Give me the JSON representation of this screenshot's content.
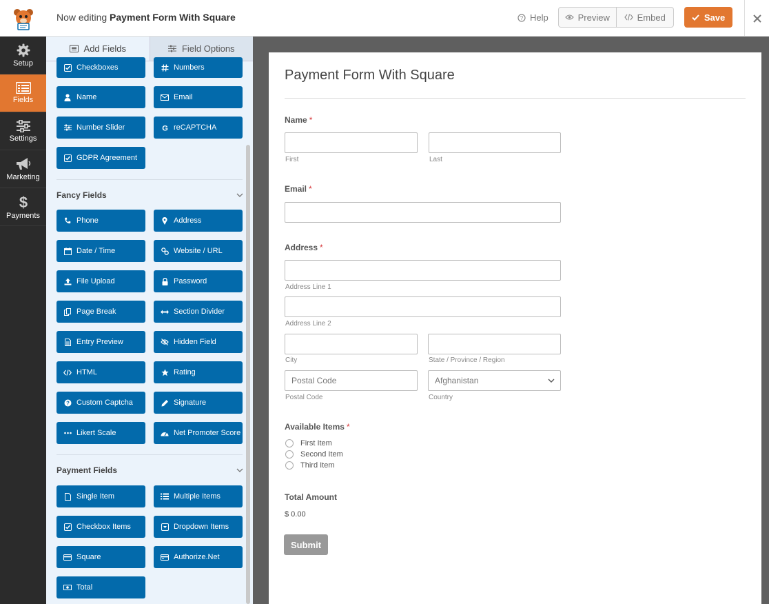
{
  "header": {
    "editing_prefix": "Now editing",
    "form_name": "Payment Form With Square",
    "help_label": "Help",
    "preview_label": "Preview",
    "embed_label": "Embed",
    "save_label": "Save",
    "accent_color": "#e27730"
  },
  "leftnav": {
    "items": [
      {
        "label": "Setup",
        "icon": "gear-icon"
      },
      {
        "label": "Fields",
        "icon": "list-icon",
        "active": true
      },
      {
        "label": "Settings",
        "icon": "sliders-icon"
      },
      {
        "label": "Marketing",
        "icon": "megaphone-icon"
      },
      {
        "label": "Payments",
        "icon": "dollar-icon"
      }
    ]
  },
  "panel": {
    "tabs": {
      "add_fields": "Add Fields",
      "field_options": "Field Options"
    },
    "standard_fields": [
      {
        "label": "Checkboxes",
        "icon": "checkbox-icon"
      },
      {
        "label": "Numbers",
        "icon": "hash-icon"
      },
      {
        "label": "Name",
        "icon": "user-icon"
      },
      {
        "label": "Email",
        "icon": "envelope-icon"
      },
      {
        "label": "Number Slider",
        "icon": "sliders-icon"
      },
      {
        "label": "reCAPTCHA",
        "icon": "google-icon"
      },
      {
        "label": "GDPR Agreement",
        "icon": "checkbox-icon"
      }
    ],
    "fancy_title": "Fancy Fields",
    "fancy_fields": [
      {
        "label": "Phone",
        "icon": "phone-icon"
      },
      {
        "label": "Address",
        "icon": "map-pin-icon"
      },
      {
        "label": "Date / Time",
        "icon": "calendar-icon"
      },
      {
        "label": "Website / URL",
        "icon": "link-icon"
      },
      {
        "label": "File Upload",
        "icon": "upload-icon"
      },
      {
        "label": "Password",
        "icon": "lock-icon"
      },
      {
        "label": "Page Break",
        "icon": "copy-icon"
      },
      {
        "label": "Section Divider",
        "icon": "arrows-h-icon"
      },
      {
        "label": "Entry Preview",
        "icon": "file-text-icon"
      },
      {
        "label": "Hidden Field",
        "icon": "eye-slash-icon"
      },
      {
        "label": "HTML",
        "icon": "code-icon"
      },
      {
        "label": "Rating",
        "icon": "star-icon"
      },
      {
        "label": "Custom Captcha",
        "icon": "question-circle-icon"
      },
      {
        "label": "Signature",
        "icon": "pencil-icon"
      },
      {
        "label": "Likert Scale",
        "icon": "ellipsis-icon"
      },
      {
        "label": "Net Promoter Score",
        "icon": "tachometer-icon"
      }
    ],
    "payment_title": "Payment Fields",
    "payment_fields": [
      {
        "label": "Single Item",
        "icon": "file-icon"
      },
      {
        "label": "Multiple Items",
        "icon": "list-icon"
      },
      {
        "label": "Checkbox Items",
        "icon": "checkbox-icon"
      },
      {
        "label": "Dropdown Items",
        "icon": "caret-square-icon"
      },
      {
        "label": "Square",
        "icon": "credit-card-icon"
      },
      {
        "label": "Authorize.Net",
        "icon": "bank-icon"
      },
      {
        "label": "Total",
        "icon": "money-icon"
      }
    ],
    "button_color": "#036aab"
  },
  "form": {
    "title": "Payment Form With Square",
    "name": {
      "label": "Name",
      "req": "*",
      "first": "First",
      "last": "Last"
    },
    "email": {
      "label": "Email",
      "req": "*"
    },
    "address": {
      "label": "Address",
      "req": "*",
      "line1": "Address Line 1",
      "line2": "Address Line 2",
      "city": "City",
      "state": "State / Province / Region",
      "postal_placeholder": "Postal Code",
      "postal": "Postal Code",
      "country_value": "Afghanistan",
      "country": "Country"
    },
    "items": {
      "label": "Available Items",
      "req": "*",
      "options": [
        "First Item",
        "Second Item",
        "Third Item"
      ]
    },
    "total": {
      "label": "Total Amount",
      "value": "$ 0.00"
    },
    "submit_label": "Submit"
  }
}
